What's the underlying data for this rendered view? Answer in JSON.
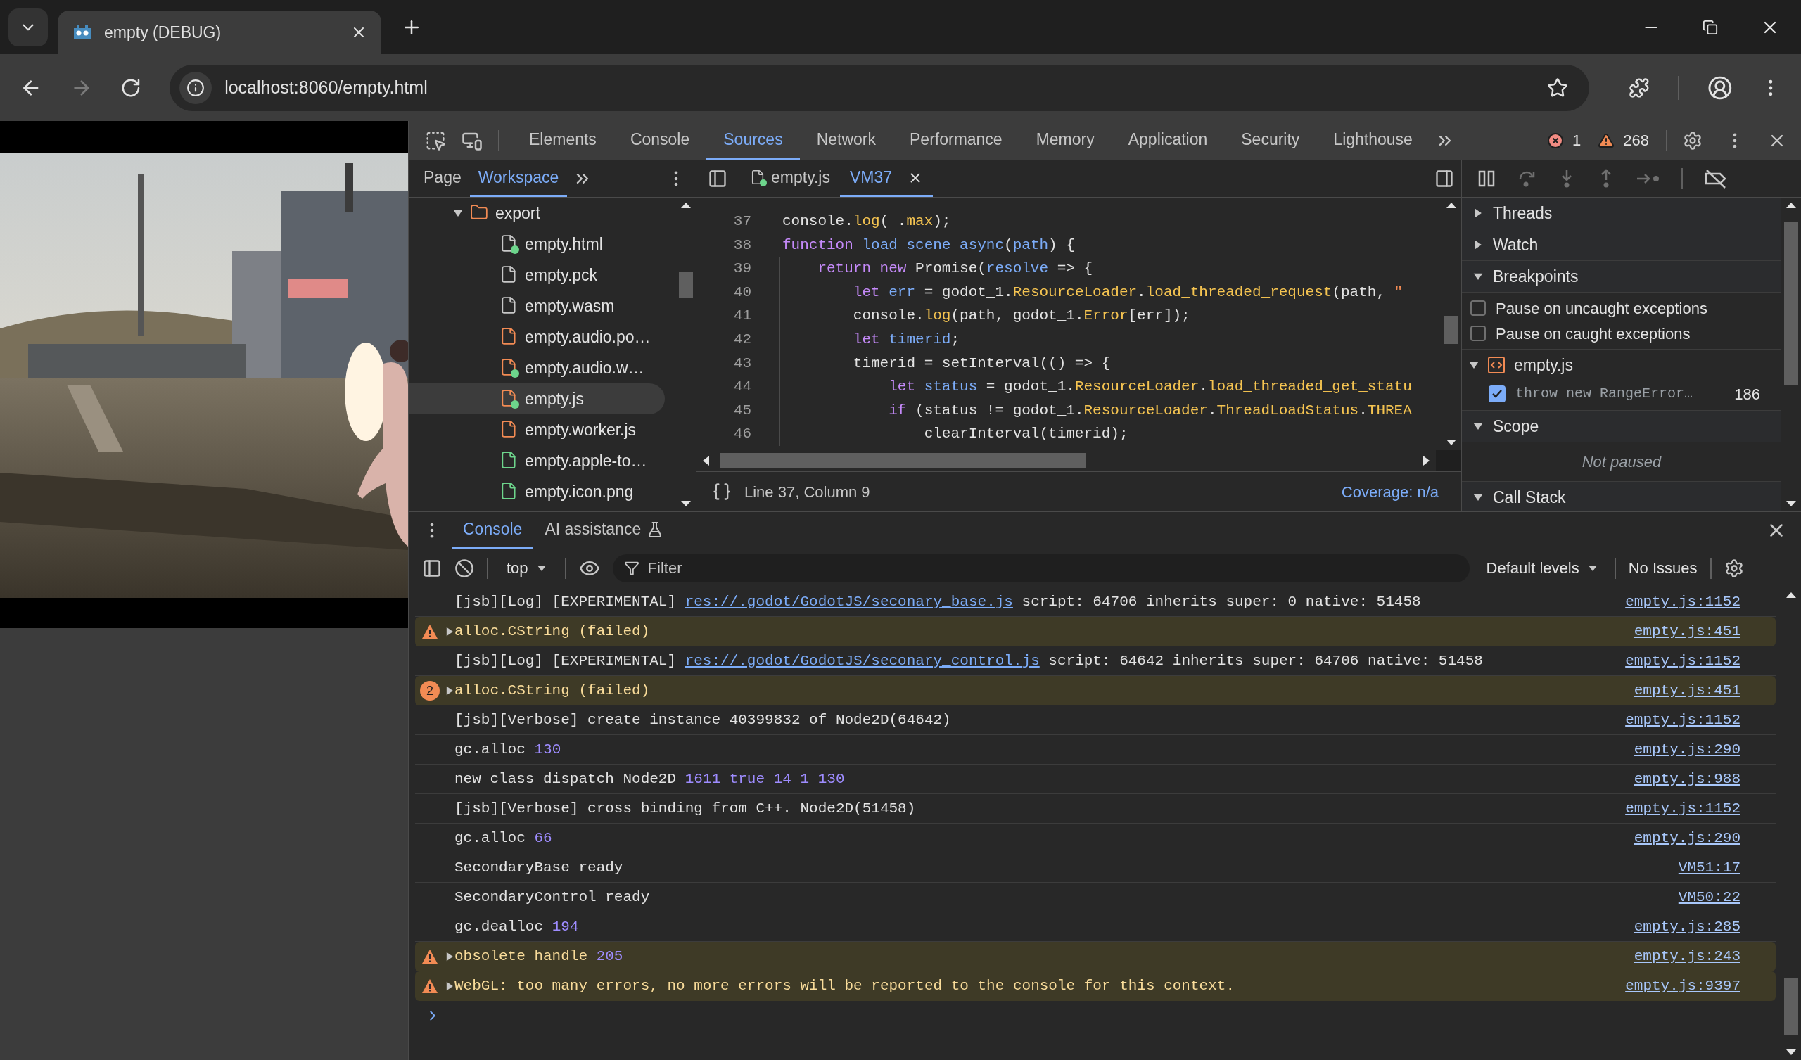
{
  "browser": {
    "tab": {
      "title": "empty (DEBUG)"
    },
    "address": "localhost:8060/empty.html"
  },
  "devtools": {
    "tabs": [
      {
        "label": "Elements",
        "selected": false
      },
      {
        "label": "Console",
        "selected": false
      },
      {
        "label": "Sources",
        "selected": true
      },
      {
        "label": "Network",
        "selected": false
      },
      {
        "label": "Performance",
        "selected": false
      },
      {
        "label": "Memory",
        "selected": false
      },
      {
        "label": "Application",
        "selected": false
      },
      {
        "label": "Security",
        "selected": false
      },
      {
        "label": "Lighthouse",
        "selected": false
      }
    ],
    "error_count": "1",
    "warning_count": "268"
  },
  "sources": {
    "navigator": {
      "tabs": [
        {
          "label": "Page",
          "selected": false
        },
        {
          "label": "Workspace",
          "selected": true
        }
      ],
      "files": [
        {
          "name": "export",
          "kind": "folder",
          "expanded": true,
          "children": [
            {
              "name": "empty.html",
              "kind": "document",
              "synced": true,
              "selected": false
            },
            {
              "name": "empty.pck",
              "kind": "document",
              "synced": false,
              "selected": false
            },
            {
              "name": "empty.wasm",
              "kind": "document",
              "synced": false,
              "selected": false
            },
            {
              "name": "empty.audio.po…",
              "kind": "script",
              "synced": false,
              "selected": false
            },
            {
              "name": "empty.audio.w…",
              "kind": "script",
              "synced": true,
              "selected": false
            },
            {
              "name": "empty.js",
              "kind": "script",
              "synced": true,
              "selected": true
            },
            {
              "name": "empty.worker.js",
              "kind": "script",
              "synced": false,
              "selected": false
            },
            {
              "name": "empty.apple-to…",
              "synced": false,
              "selected": false
            },
            {
              "name": "empty.icon.png",
              "synced": false,
              "selected": false
            }
          ]
        }
      ]
    },
    "editor": {
      "tabs": [
        {
          "label": "empty.js",
          "selected": false,
          "synced": true,
          "closable": false
        },
        {
          "label": "VM37",
          "selected": true,
          "synced": false,
          "closable": true
        }
      ],
      "lines": [
        {
          "number": "37",
          "tokens": [
            {
              "t": "console.",
              "kind": "plain"
            },
            {
              "t": "log",
              "kind": "api"
            },
            {
              "t": "(_.",
              "kind": "plain"
            },
            {
              "t": "max",
              "kind": "api"
            },
            {
              "t": ");",
              "kind": "plain"
            }
          ]
        },
        {
          "number": "38",
          "tokens": [
            {
              "t": "function",
              "kind": "kw"
            },
            {
              "t": " load_scene_async",
              "kind": "def"
            },
            {
              "t": "(",
              "kind": "plain"
            },
            {
              "t": "path",
              "kind": "def"
            },
            {
              "t": ") {",
              "kind": "plain"
            }
          ]
        },
        {
          "number": "39",
          "tokens": [
            {
              "t": "    return new",
              "kind": "kw"
            },
            {
              "t": " Promise(",
              "kind": "plain"
            },
            {
              "t": "resolve",
              "kind": "def"
            },
            {
              "t": " => {",
              "kind": "plain"
            }
          ]
        },
        {
          "number": "40",
          "tokens": [
            {
              "t": "        let",
              "kind": "kw"
            },
            {
              "t": " err",
              "kind": "def"
            },
            {
              "t": " = godot_1.",
              "kind": "plain"
            },
            {
              "t": "ResourceLoader",
              "kind": "api"
            },
            {
              "t": ".",
              "kind": "plain"
            },
            {
              "t": "load_threaded_request",
              "kind": "api"
            },
            {
              "t": "(path, ",
              "kind": "plain"
            },
            {
              "t": "\"",
              "kind": "str"
            }
          ]
        },
        {
          "number": "41",
          "tokens": [
            {
              "t": "        console.",
              "kind": "plain"
            },
            {
              "t": "log",
              "kind": "api"
            },
            {
              "t": "(path, godot_1.",
              "kind": "plain"
            },
            {
              "t": "Error",
              "kind": "api"
            },
            {
              "t": "[err]);",
              "kind": "plain"
            }
          ]
        },
        {
          "number": "42",
          "tokens": [
            {
              "t": "        let",
              "kind": "kw"
            },
            {
              "t": " timerid",
              "kind": "def"
            },
            {
              "t": ";",
              "kind": "plain"
            }
          ]
        },
        {
          "number": "43",
          "tokens": [
            {
              "t": "        timerid = setInterval(() => {",
              "kind": "plain"
            }
          ]
        },
        {
          "number": "44",
          "tokens": [
            {
              "t": "            let",
              "kind": "kw"
            },
            {
              "t": " status",
              "kind": "def"
            },
            {
              "t": " = godot_1.",
              "kind": "plain"
            },
            {
              "t": "ResourceLoader",
              "kind": "api"
            },
            {
              "t": ".",
              "kind": "plain"
            },
            {
              "t": "load_threaded_get_statu",
              "kind": "api"
            }
          ]
        },
        {
          "number": "45",
          "tokens": [
            {
              "t": "            if",
              "kind": "kw"
            },
            {
              "t": " (status != godot_1.",
              "kind": "plain"
            },
            {
              "t": "ResourceLoader",
              "kind": "api"
            },
            {
              "t": ".",
              "kind": "plain"
            },
            {
              "t": "ThreadLoadStatus",
              "kind": "api"
            },
            {
              "t": ".",
              "kind": "plain"
            },
            {
              "t": "THREA",
              "kind": "api"
            }
          ]
        },
        {
          "number": "46",
          "tokens": [
            {
              "t": "                clearInterval(timerid);",
              "kind": "plain"
            }
          ]
        }
      ],
      "status": {
        "position": "Line 37, Column 9",
        "coverage": "Coverage: n/a"
      }
    },
    "debugger": {
      "sections": [
        {
          "title": "Threads",
          "expanded": false
        },
        {
          "title": "Watch",
          "expanded": false
        },
        {
          "title": "Breakpoints",
          "expanded": true,
          "options": [
            {
              "label": "Pause on uncaught exceptions",
              "checked": false
            },
            {
              "label": "Pause on caught exceptions",
              "checked": false
            }
          ],
          "groups": [
            {
              "file": "empty.js",
              "expanded": true,
              "items": [
                {
                  "code": "throw new RangeError…",
                  "line": "186",
                  "checked": true
                }
              ]
            }
          ]
        },
        {
          "title": "Scope",
          "expanded": true,
          "message": "Not paused"
        },
        {
          "title": "Call Stack",
          "expanded": true
        }
      ]
    }
  },
  "drawer": {
    "tabs": [
      {
        "label": "Console",
        "selected": true,
        "experimental": false
      },
      {
        "label": "AI assistance",
        "selected": false,
        "experimental": true
      }
    ],
    "toolbar": {
      "context": "top",
      "filter_placeholder": "Filter",
      "levels": "Default levels",
      "issues": "No Issues"
    },
    "messages": [
      {
        "kind": "log",
        "expandable": false,
        "parts": [
          {
            "t": "[jsb][Log] [EXPERIMENTAL] ",
            "kind": "text"
          },
          {
            "t": "res://.godot/GodotJS/seconary_base.js",
            "kind": "link"
          },
          {
            "t": " script: 64706 inherits super: 0 native: 51458",
            "kind": "text"
          }
        ],
        "source": "empty.js:1152"
      },
      {
        "kind": "warning",
        "expandable": true,
        "parts": [
          {
            "t": "alloc.CString (failed)",
            "kind": "text"
          }
        ],
        "source": "empty.js:451"
      },
      {
        "kind": "log",
        "expandable": false,
        "parts": [
          {
            "t": "[jsb][Log] [EXPERIMENTAL] ",
            "kind": "text"
          },
          {
            "t": "res://.godot/GodotJS/seconary_control.js",
            "kind": "link"
          },
          {
            "t": " script: 64642 inherits super: 64706 native: 51458",
            "kind": "text"
          }
        ],
        "source": "empty.js:1152"
      },
      {
        "kind": "warning",
        "expandable": true,
        "count": "2",
        "parts": [
          {
            "t": "alloc.CString (failed)",
            "kind": "text"
          }
        ],
        "source": "empty.js:451"
      },
      {
        "kind": "log",
        "expandable": false,
        "parts": [
          {
            "t": "[jsb][Verbose] create instance 40399832 of Node2D(64642)",
            "kind": "text"
          }
        ],
        "source": "empty.js:1152"
      },
      {
        "kind": "log",
        "expandable": false,
        "parts": [
          {
            "t": "gc.alloc ",
            "kind": "text"
          },
          {
            "t": "130",
            "kind": "num"
          }
        ],
        "source": "empty.js:290"
      },
      {
        "kind": "log",
        "expandable": false,
        "parts": [
          {
            "t": "new class dispatch Node2D ",
            "kind": "text"
          },
          {
            "t": "1611 true 14 1 130",
            "kind": "num"
          }
        ],
        "source": "empty.js:988"
      },
      {
        "kind": "log",
        "expandable": false,
        "parts": [
          {
            "t": "[jsb][Verbose] cross binding from C++. Node2D(51458)",
            "kind": "text"
          }
        ],
        "source": "empty.js:1152"
      },
      {
        "kind": "log",
        "expandable": false,
        "parts": [
          {
            "t": "gc.alloc ",
            "kind": "text"
          },
          {
            "t": "66",
            "kind": "num"
          }
        ],
        "source": "empty.js:290"
      },
      {
        "kind": "log",
        "expandable": false,
        "parts": [
          {
            "t": "SecondaryBase ready",
            "kind": "text"
          }
        ],
        "source": "VM51:17"
      },
      {
        "kind": "log",
        "expandable": false,
        "parts": [
          {
            "t": "SecondaryControl ready",
            "kind": "text"
          }
        ],
        "source": "VM50:22"
      },
      {
        "kind": "log",
        "expandable": false,
        "parts": [
          {
            "t": "gc.dealloc ",
            "kind": "text"
          },
          {
            "t": "194",
            "kind": "num"
          }
        ],
        "source": "empty.js:285"
      },
      {
        "kind": "warning",
        "expandable": true,
        "parts": [
          {
            "t": "obsolete handle ",
            "kind": "text"
          },
          {
            "t": "205",
            "kind": "num"
          }
        ],
        "source": "empty.js:243"
      },
      {
        "kind": "warning",
        "expandable": true,
        "parts": [
          {
            "t": "WebGL: too many errors, no more errors will be reported to the console for this context.",
            "kind": "text"
          }
        ],
        "source": "empty.js:9397"
      }
    ]
  }
}
